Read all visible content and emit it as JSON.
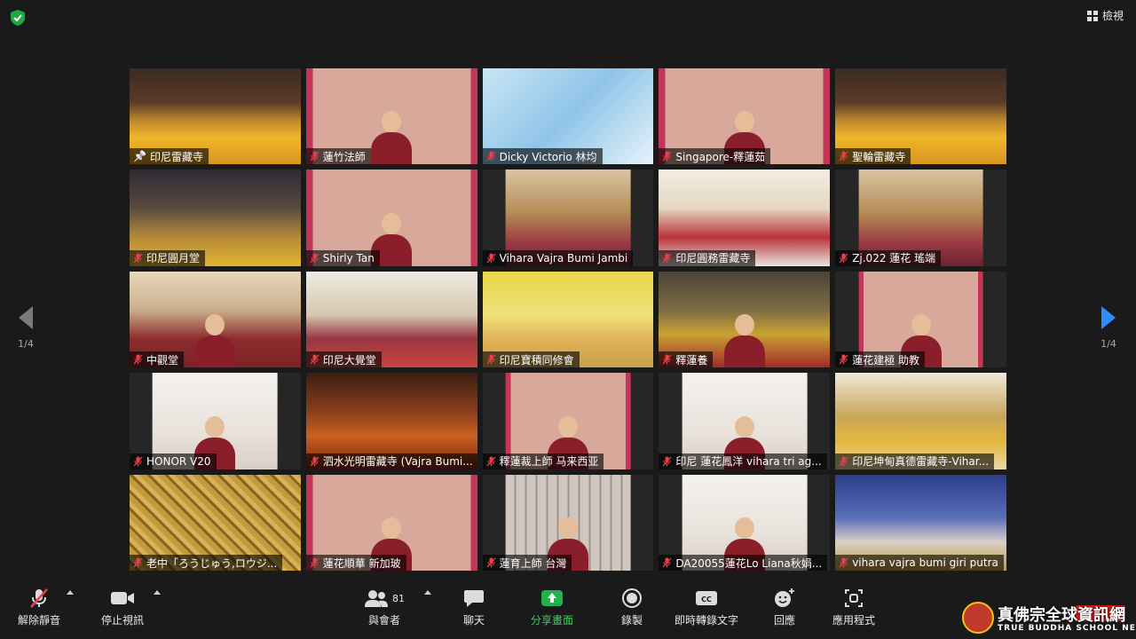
{
  "top": {
    "view_label": "檢視"
  },
  "pager": {
    "left_label": "1/4",
    "right_label": "1/4"
  },
  "colors": {
    "active_speaker": "#c8e24a",
    "mic_muted": "#e8414b",
    "share": "#22b14c",
    "next_arrow": "#2d8cff"
  },
  "participants": [
    {
      "name": "印尼雷藏寺",
      "bg": "shrine",
      "active": true,
      "pinned": true
    },
    {
      "name": "蓮竹法師",
      "bg": "thangka"
    },
    {
      "name": "Dicky Victorio 林均",
      "bg": "buddha"
    },
    {
      "name": "Singapore-釋蓮茹",
      "bg": "thangka"
    },
    {
      "name": "聖輪雷藏寺",
      "bg": "shrine"
    },
    {
      "name": "印尼圓月堂",
      "bg": "temple"
    },
    {
      "name": "Shirly Tan",
      "bg": "thangka"
    },
    {
      "name": "Vihara Vajra Bumi Jambi",
      "bg": "group",
      "pillar": true
    },
    {
      "name": "印尼圓務雷藏寺",
      "bg": "hall"
    },
    {
      "name": "Zj.022 蓮花 瑤端",
      "bg": "group",
      "pillar": true
    },
    {
      "name": "中觀堂",
      "bg": "room"
    },
    {
      "name": "印尼大覺堂",
      "bg": "hallwhite"
    },
    {
      "name": "印尼寶積同修會",
      "bg": "yellow"
    },
    {
      "name": "釋蓮養",
      "bg": "monk"
    },
    {
      "name": "蓮花建極 助教",
      "bg": "thangka",
      "pillar": true
    },
    {
      "name": "HONOR V20",
      "bg": "white",
      "pillar": true
    },
    {
      "name": "泗水光明雷藏寺 (Vajra Bumi...",
      "bg": "altar"
    },
    {
      "name": "釋蓮裁上師 马来西亚",
      "bg": "thangka",
      "pillar": true
    },
    {
      "name": "印尼 蓮花鳳洋 vihara tri ag...",
      "bg": "white",
      "pillar": true
    },
    {
      "name": "印尼坤甸真德雷藏寺-Vihar...",
      "bg": "temple2"
    },
    {
      "name": "老中「ろうじゅう,ロウジ...",
      "bg": "seal"
    },
    {
      "name": "蓮花順華 新加玻",
      "bg": "thangka"
    },
    {
      "name": "蓮育上師 台灣",
      "bg": "shelf",
      "pillar": true
    },
    {
      "name": "DA20055蓮花Lo Liana秋娟...",
      "bg": "white",
      "pillar": true
    },
    {
      "name": "vihara vajra bumi giri putra",
      "bg": "bluehall"
    }
  ],
  "toolbar": {
    "unmute": "解除靜音",
    "stop_video": "停止視訊",
    "participants": "與會者",
    "participant_count": "81",
    "chat": "聊天",
    "share": "分享畫面",
    "record": "錄製",
    "captions": "即時轉錄文字",
    "reactions": "回應",
    "apps": "應用程式"
  },
  "watermark": {
    "text": "真佛宗全球資訊網",
    "sub": "TRUE BUDDHA SCHOOL NET"
  }
}
